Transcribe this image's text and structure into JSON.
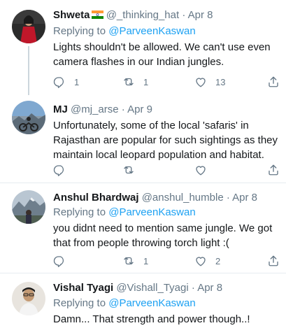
{
  "tweets": [
    {
      "name": "Shweta",
      "handle": "@_thinking_hat",
      "time": "Apr 8",
      "replying_label": "Replying to",
      "replying_to": "@ParveenKaswan",
      "lines": [
        "Lights shouldn't be allowed. We can't use even",
        "camera flashes in our Indian jungles."
      ],
      "counts": {
        "reply": "1",
        "retweet": "1",
        "like": "13"
      }
    },
    {
      "name": "MJ",
      "handle": "@mj_arse",
      "time": "Apr 9",
      "lines": [
        "Unfortunately, some of the local 'safaris' in",
        "Rajasthan are popular for such sightings as they",
        "maintain local leopard population and habitat."
      ],
      "counts": {
        "reply": "",
        "retweet": "",
        "like": ""
      }
    },
    {
      "name": "Anshul Bhardwaj",
      "handle": "@anshul_humble",
      "time": "Apr 8",
      "replying_label": "Replying to",
      "replying_to": "@ParveenKaswan",
      "lines": [
        "you didnt need to mention same jungle. We got",
        "that from people throwing torch light :("
      ],
      "counts": {
        "reply": "",
        "retweet": "1",
        "like": "2"
      }
    },
    {
      "name": "Vishal Tyagi",
      "handle": "@Vishall_Tyagi",
      "time": "Apr 8",
      "replying_label": "Replying to",
      "replying_to": "@ParveenKaswan",
      "lines": [
        "Damn... That strength and power though..!"
      ]
    }
  ],
  "separator": "·",
  "icons": [
    "reply-icon",
    "retweet-icon",
    "like-icon",
    "share-icon",
    "india-flag-icon"
  ],
  "colors": {
    "link": "#1da1f2",
    "muted": "#657786",
    "text": "#14171a",
    "border": "#e6ecf0"
  }
}
